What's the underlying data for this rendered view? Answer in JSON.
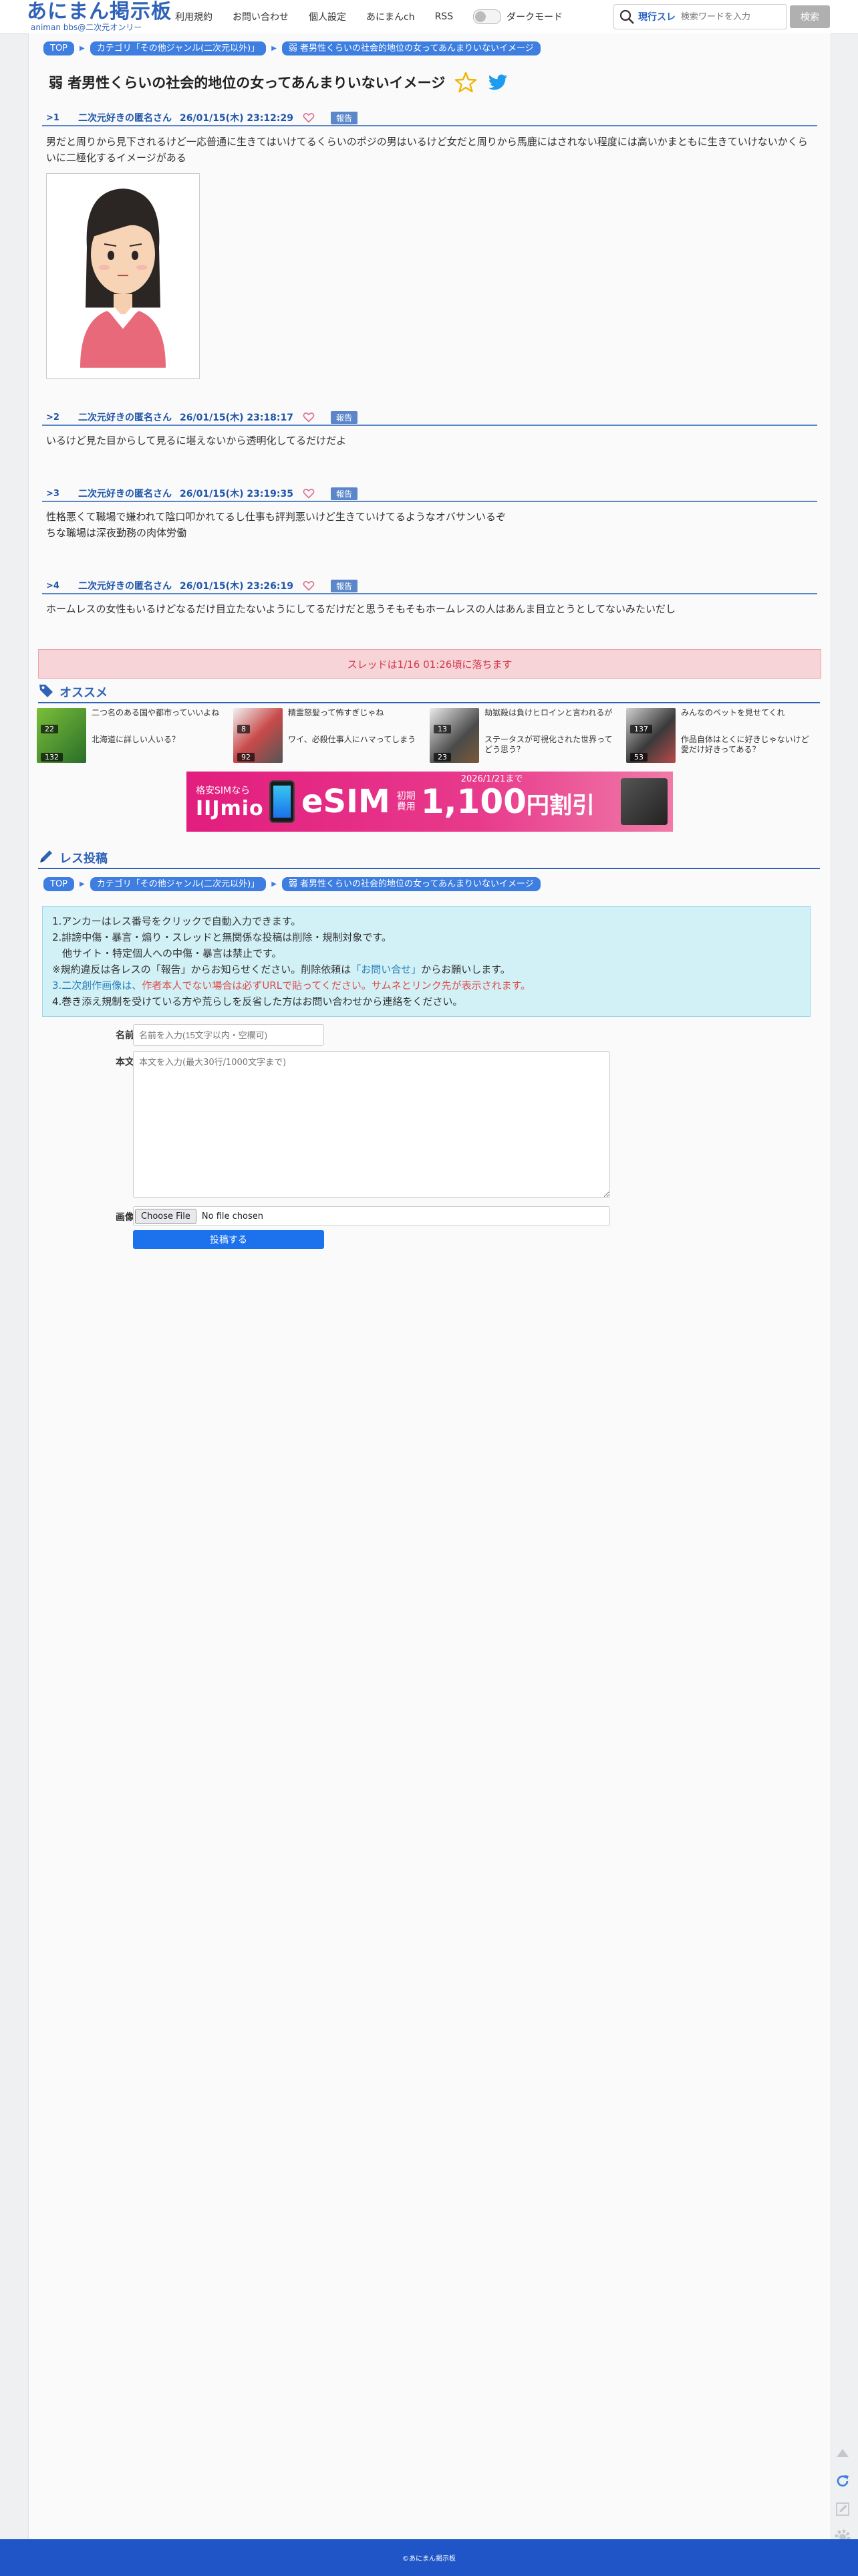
{
  "header": {
    "logo_title": "あにまん掲示板",
    "logo_sub": "animan bbs@二次元オンリー",
    "nav": [
      "利用規約",
      "お問い合わせ",
      "個人設定",
      "あにまんch",
      "RSS"
    ],
    "dark_mode_label": "ダークモード",
    "search_type": "現行スレ",
    "search_placeholder": "検索ワードを入力",
    "search_button": "検索"
  },
  "breadcrumb": {
    "top": "TOP",
    "category": "カテゴリ「その他ジャンル(二次元以外)」",
    "thread": "弱 者男性くらいの社会的地位の女ってあんまりいないイメージ"
  },
  "thread": {
    "title": "弱 者男性くらいの社会的地位の女ってあんまりいないイメージ"
  },
  "posts": [
    {
      "no": ">1",
      "name": "二次元好きの匿名さん",
      "date": "26/01/15(木) 23:12:29",
      "report": "報告",
      "body": "男だと周りから見下されるけど一応普通に生きてはいけてるくらいのポジの男はいるけど女だと周りから馬鹿にはされない程度には高いかまともに生きていけないかくらいに二極化するイメージがある"
    },
    {
      "no": ">2",
      "name": "二次元好きの匿名さん",
      "date": "26/01/15(木) 23:18:17",
      "report": "報告",
      "body": "いるけど見た目からして見るに堪えないから透明化してるだけだよ"
    },
    {
      "no": ">3",
      "name": "二次元好きの匿名さん",
      "date": "26/01/15(木) 23:19:35",
      "report": "報告",
      "body": "性格悪くて職場で嫌われて陰口叩かれてるし仕事も評判悪いけど生きていけてるようなオバサンいるぞ",
      "body2": "ちな職場は深夜勤務の肉体労働"
    },
    {
      "no": ">4",
      "name": "二次元好きの匿名さん",
      "date": "26/01/15(木) 23:26:19",
      "report": "報告",
      "body": "ホームレスの女性もいるけどなるだけ目立たないようにしてるだけだと思うそもそもホームレスの人はあんま目立とうとしてないみたいだし"
    }
  ],
  "deadline": "スレッドは1/16 01:26頃に落ちます",
  "recommend": {
    "heading": "オススメ",
    "items": [
      {
        "line1": "二つ名のある国や都市っていいよね",
        "line2": "北海道に詳しい人いる？",
        "count": "22",
        "count2": "132"
      },
      {
        "line1": "精霊怒髪って怖すぎじゃね",
        "line2": "ワイ、必殺仕事人にハマってしまう",
        "count": "8",
        "count2": "92"
      },
      {
        "line1": "劫獄殺は負けヒロインと言われるが",
        "line2": "ステータスが可視化された世界ってどう思う？",
        "count": "13",
        "count2": "23"
      },
      {
        "line1": "みんなのペットを見せてくれ",
        "line2": "作品自体はとくに好きじゃないけど愛だけ好きってある？",
        "count": "137",
        "count2": "53"
      }
    ]
  },
  "ad": {
    "line1": "格安SIMなら",
    "brand": "IIJmio",
    "esim": "eSIM",
    "fee_label1": "初期",
    "fee_label2": "費用",
    "price": "1,100",
    "discount": "円割引",
    "until": "2026/1/21まで"
  },
  "reply": {
    "heading": "レス投稿",
    "rules": [
      "1.アンカーはレス番号をクリックで自動入力できます。",
      "2.誹謗中傷・暴言・煽り・スレッドと無関係な投稿は削除・規制対象です。",
      "　他サイト・特定個人への中傷・暴言は禁止です。",
      "※規約違反は各レスの「報告」からお知らせください。削除依頼は",
      "「お問い合せ」",
      "からお願いします。",
      "3.二次創作画像は、",
      "作者本人でない場合は必ずURLで貼ってください。",
      "サムネとリンク先が表示されます。",
      "4.巻き添え規制を受けている方や荒らしを反省した方はお問い合わせから連絡をください。"
    ],
    "name_label": "名前",
    "name_placeholder": "名前を入力(15文字以内・空欄可)",
    "body_label": "本文",
    "body_placeholder": "本文を入力(最大30行/1000文字まで)",
    "image_label": "画像",
    "file_button": "Choose File",
    "file_status": "No file chosen",
    "submit": "投稿する"
  },
  "footer": "©あにまん掲示板",
  "colors": {
    "accent": "#2f62b8",
    "crumb": "#3d7ee0",
    "footer": "#1f55c6",
    "deadline_bg": "#f6d4d8",
    "rules_bg": "#d2f1f7",
    "submit": "#1b72ec"
  }
}
